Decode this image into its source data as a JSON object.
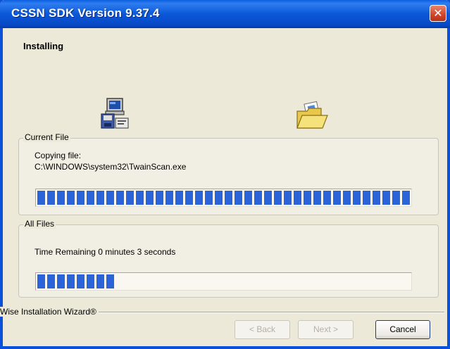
{
  "window": {
    "title": "CSSN SDK Version 9.37.4",
    "close_label": "✕"
  },
  "header": {
    "heading": "Installing"
  },
  "icons": {
    "source": "computer-disk-icon",
    "destination": "open-folder-icon"
  },
  "current_file": {
    "legend": "Current File",
    "action": "Copying file:",
    "path": "C:\\WINDOWS\\system32\\TwainScan.exe",
    "progress": 1.0
  },
  "all_files": {
    "legend": "All Files",
    "time_remaining": "Time Remaining 0 minutes 3 seconds",
    "progress": 0.21
  },
  "footer": {
    "brand": "Wise Installation Wizard®",
    "back_label": "< Back",
    "next_label": "Next >",
    "cancel_label": "Cancel"
  },
  "colors": {
    "titlebar": "#0b58d8",
    "progress_block": "#2a64d8",
    "close_button": "#d0452a"
  }
}
